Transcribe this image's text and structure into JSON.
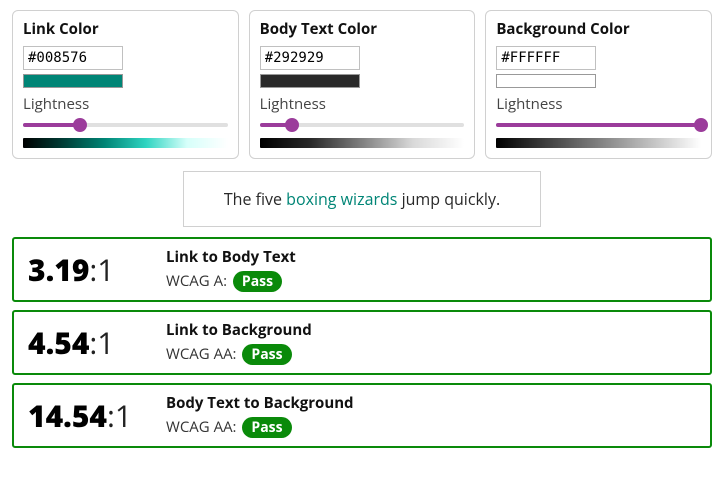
{
  "panels": {
    "link": {
      "title": "Link Color",
      "hex": "#008576",
      "lightness_label": "Lightness",
      "lightness_pct": 28
    },
    "body": {
      "title": "Body Text Color",
      "hex": "#292929",
      "lightness_label": "Lightness",
      "lightness_pct": 16
    },
    "bg": {
      "title": "Background Color",
      "hex": "#FFFFFF",
      "lightness_label": "Lightness",
      "lightness_pct": 100
    }
  },
  "sample": {
    "before": "The five ",
    "link_text": "boxing wizards",
    "after": " jump quickly."
  },
  "results": [
    {
      "ratio_main": "3.19",
      "ratio_suffix": ":1",
      "title": "Link to Body Text",
      "level_label": "WCAG A: ",
      "status": "Pass"
    },
    {
      "ratio_main": "4.54",
      "ratio_suffix": ":1",
      "title": "Link to Background",
      "level_label": "WCAG AA: ",
      "status": "Pass"
    },
    {
      "ratio_main": "14.54",
      "ratio_suffix": ":1",
      "title": "Body Text to Background",
      "level_label": "WCAG AA: ",
      "status": "Pass"
    }
  ]
}
